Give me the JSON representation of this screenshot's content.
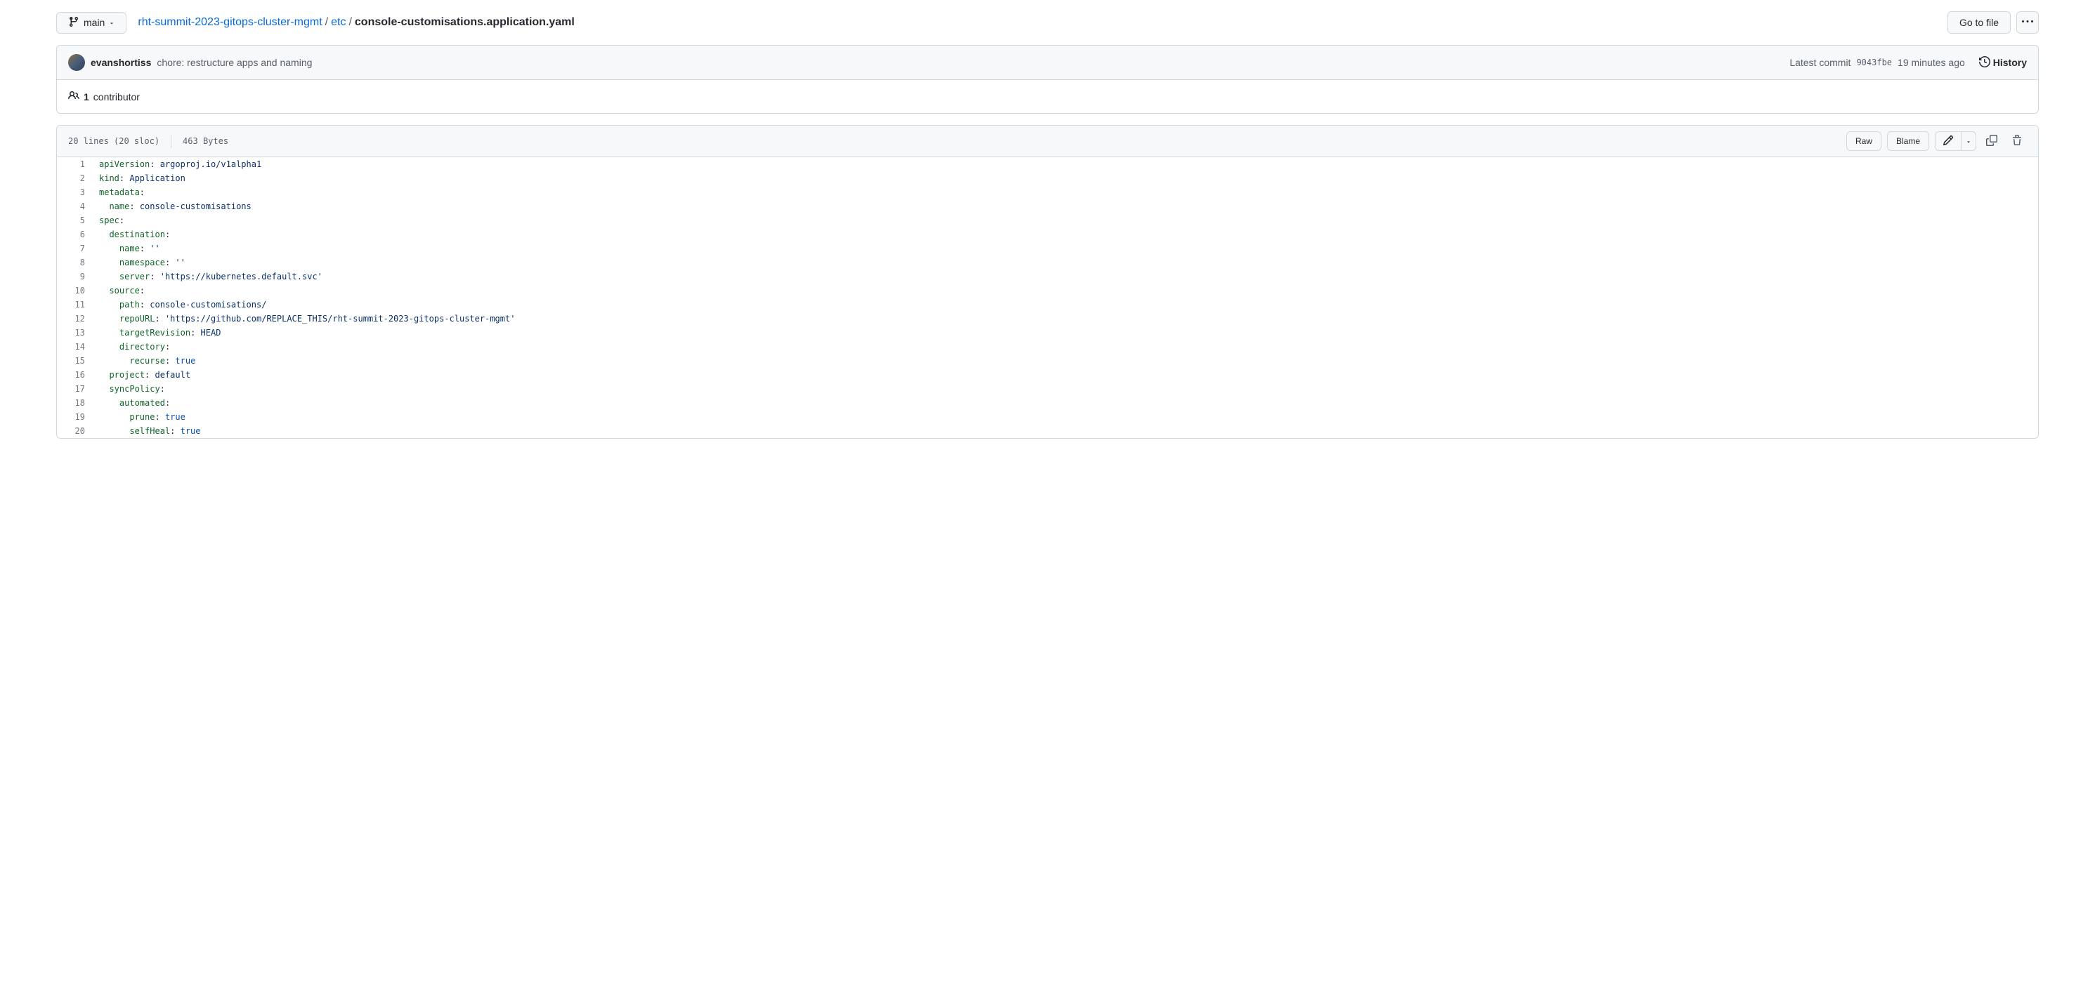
{
  "branch": {
    "name": "main"
  },
  "breadcrumb": {
    "repo": "rht-summit-2023-gitops-cluster-mgmt",
    "folder": "etc",
    "file": "console-customisations.application.yaml",
    "sep": "/"
  },
  "buttons": {
    "go_to_file": "Go to file",
    "raw": "Raw",
    "blame": "Blame"
  },
  "commit": {
    "author": "evanshortiss",
    "message": "chore: restructure apps and naming",
    "latest_label": "Latest commit",
    "sha": "9043fbe",
    "time": "19 minutes ago",
    "history": "History"
  },
  "contributors": {
    "count": "1",
    "label": "contributor"
  },
  "file_meta": {
    "lines": "20 lines (20 sloc)",
    "bytes": "463 Bytes"
  },
  "code_lines": [
    {
      "n": "1",
      "html": "<span class='pl-ent'>apiVersion</span>: <span class='pl-s'>argoproj.io/v1alpha1</span>"
    },
    {
      "n": "2",
      "html": "<span class='pl-ent'>kind</span>: <span class='pl-s'>Application</span>"
    },
    {
      "n": "3",
      "html": "<span class='pl-ent'>metadata</span>:"
    },
    {
      "n": "4",
      "html": "  <span class='pl-ent'>name</span>: <span class='pl-s'>console-customisations</span>"
    },
    {
      "n": "5",
      "html": "<span class='pl-ent'>spec</span>:"
    },
    {
      "n": "6",
      "html": "  <span class='pl-ent'>destination</span>:"
    },
    {
      "n": "7",
      "html": "    <span class='pl-ent'>name</span>: <span class='pl-s'>''</span>"
    },
    {
      "n": "8",
      "html": "    <span class='pl-ent'>namespace</span>: <span class='pl-s'>''</span>"
    },
    {
      "n": "9",
      "html": "    <span class='pl-ent'>server</span>: <span class='pl-s'>'https://kubernetes.default.svc'</span>"
    },
    {
      "n": "10",
      "html": "  <span class='pl-ent'>source</span>:"
    },
    {
      "n": "11",
      "html": "    <span class='pl-ent'>path</span>: <span class='pl-s'>console-customisations/</span>"
    },
    {
      "n": "12",
      "html": "    <span class='pl-ent'>repoURL</span>: <span class='pl-s'>'https://github.com/REPLACE_THIS/rht-summit-2023-gitops-cluster-mgmt'</span>"
    },
    {
      "n": "13",
      "html": "    <span class='pl-ent'>targetRevision</span>: <span class='pl-s'>HEAD</span>"
    },
    {
      "n": "14",
      "html": "    <span class='pl-ent'>directory</span>:"
    },
    {
      "n": "15",
      "html": "      <span class='pl-ent'>recurse</span>: <span class='pl-c1'>true</span>"
    },
    {
      "n": "16",
      "html": "  <span class='pl-ent'>project</span>: <span class='pl-s'>default</span>"
    },
    {
      "n": "17",
      "html": "  <span class='pl-ent'>syncPolicy</span>:"
    },
    {
      "n": "18",
      "html": "    <span class='pl-ent'>automated</span>:"
    },
    {
      "n": "19",
      "html": "      <span class='pl-ent'>prune</span>: <span class='pl-c1'>true</span>"
    },
    {
      "n": "20",
      "html": "      <span class='pl-ent'>selfHeal</span>: <span class='pl-c1'>true</span>"
    }
  ]
}
